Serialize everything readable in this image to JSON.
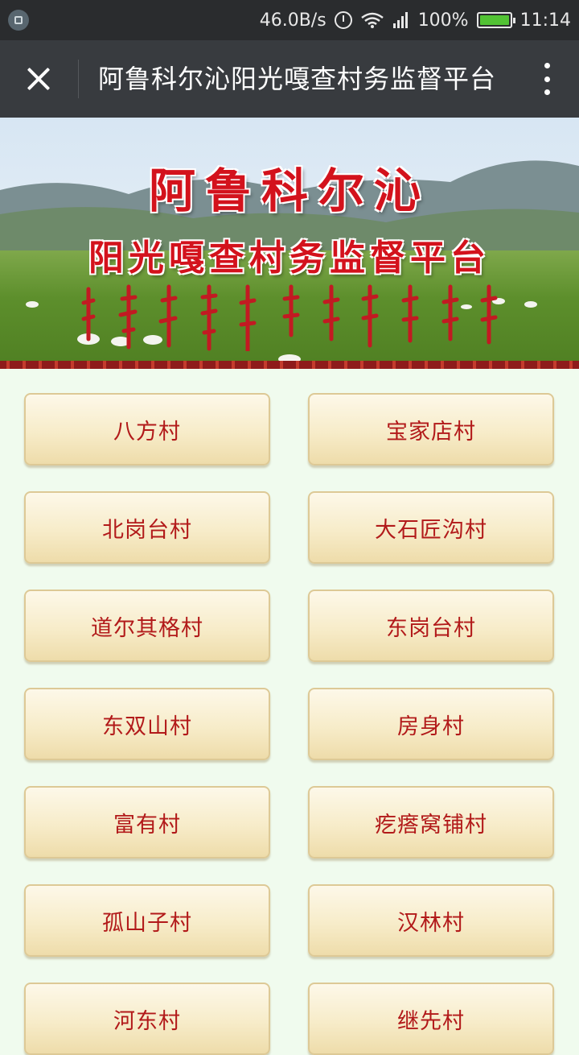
{
  "status_bar": {
    "speed": "46.0B/s",
    "battery": "100%",
    "time": "11:14",
    "icons": [
      "screenshot-icon",
      "alarm-icon",
      "wifi-icon",
      "signal-icon",
      "battery-icon"
    ],
    "battery_color": "#52c234"
  },
  "app_bar": {
    "title": "阿鲁科尔沁阳光嘎查村务监督平台",
    "close_icon": "close-icon",
    "more_icon": "more-vertical-icon"
  },
  "banner": {
    "title_line1": "阿鲁科尔沁",
    "title_line2": "阳光嘎查村务监督平台",
    "title_color": "#d3121c"
  },
  "villages": [
    "八方村",
    "宝家店村",
    "北岗台村",
    "大石匠沟村",
    "道尔其格村",
    "东岗台村",
    "东双山村",
    "房身村",
    "富有村",
    "疙瘩窝铺村",
    "孤山子村",
    "汉林村",
    "河东村",
    "继先村"
  ],
  "colors": {
    "page_background": "#f0fbee",
    "button_text": "#b21a1a",
    "button_border": "#ddc996"
  }
}
